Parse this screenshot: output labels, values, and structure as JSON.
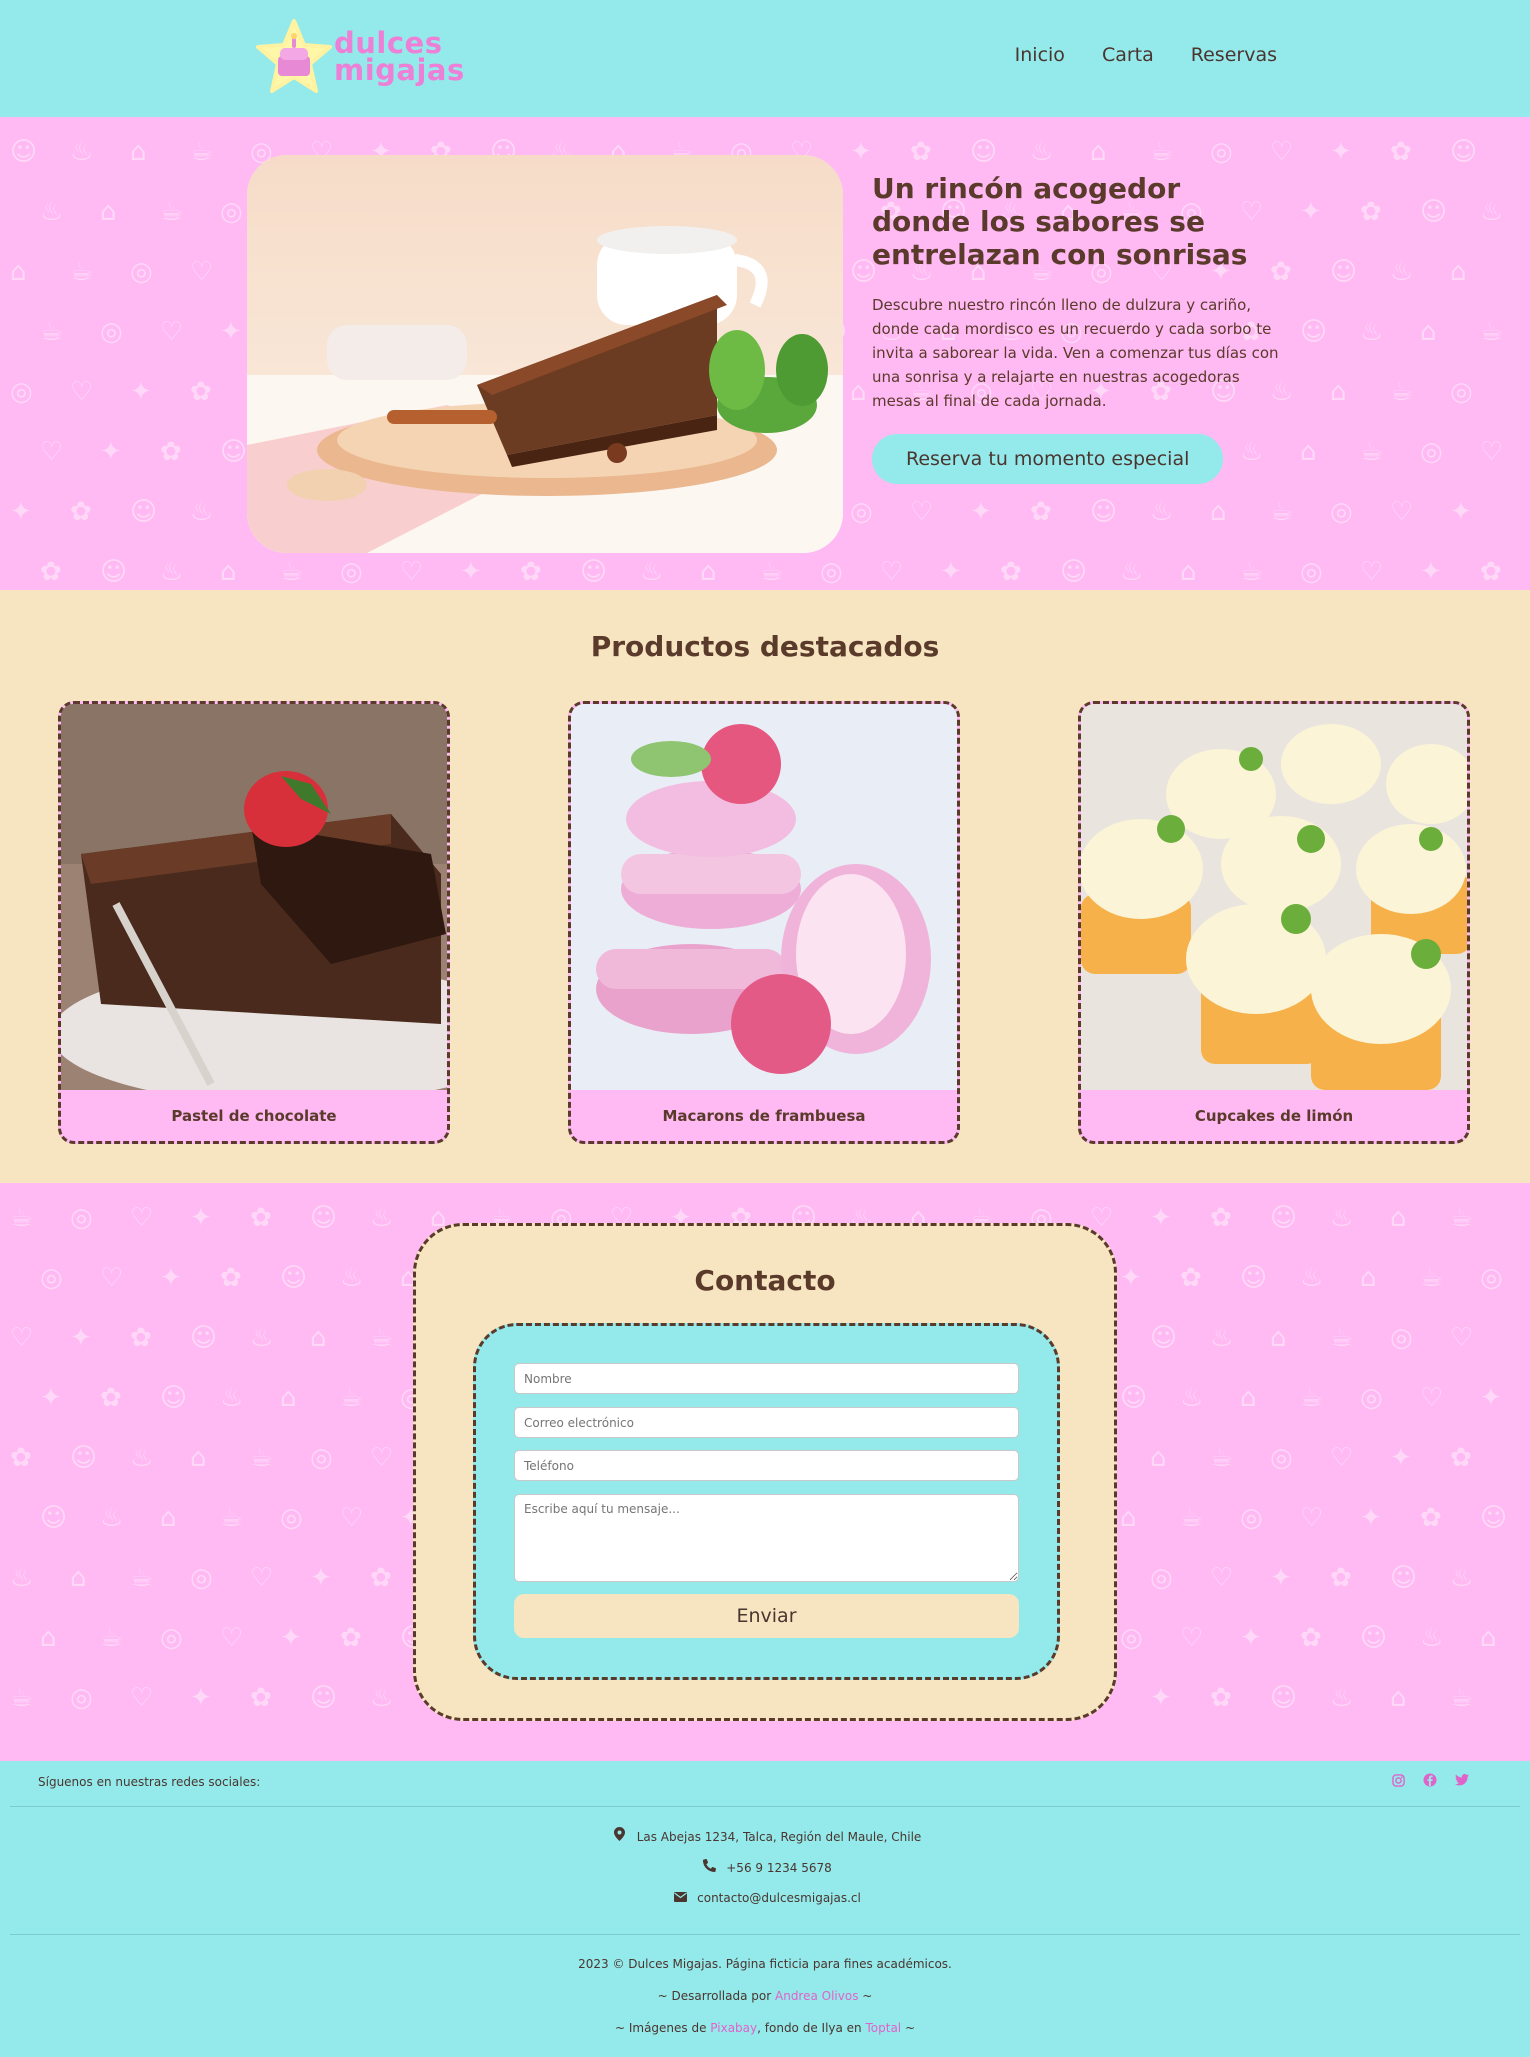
{
  "brand": {
    "line1": "dulces",
    "line2": "migajas"
  },
  "nav": {
    "items": [
      "Inicio",
      "Carta",
      "Reservas"
    ]
  },
  "hero": {
    "title": "Un rincón acogedor donde los sabores se entrelazan con sonrisas",
    "description": "Descubre nuestro rincón lleno de dulzura y cariño, donde cada mordisco es un recuerdo y cada sorbo te invita a saborear la vida. Ven a comenzar tus días con una sonrisa y a relajarte en nuestras acogedoras mesas al final de cada jornada.",
    "button": "Reserva tu momento especial"
  },
  "products": {
    "heading": "Productos destacados",
    "items": [
      {
        "name": "Pastel de chocolate"
      },
      {
        "name": "Macarons de frambuesa"
      },
      {
        "name": "Cupcakes de limón"
      }
    ]
  },
  "contact": {
    "heading": "Contacto",
    "fields": {
      "name_placeholder": "Nombre",
      "email_placeholder": "Correo electrónico",
      "phone_placeholder": "Teléfono",
      "message_placeholder": "Escribe aquí tu mensaje..."
    },
    "submit": "Enviar"
  },
  "footer": {
    "social_label": "Síguenos en nuestras redes sociales:",
    "social_icons": [
      "instagram-icon",
      "facebook-icon",
      "twitter-icon"
    ],
    "address": "Las Abejas 1234, Talca, Región del Maule, Chile",
    "phone": "+56 9 1234 5678",
    "email": "contacto@dulcesmigajas.cl",
    "copyright": "2023 © Dulces Migajas. Página ficticia para fines académicos.",
    "dev_prefix": "~ Desarrollada por ",
    "dev_name": "Andrea Olivos",
    "dev_suffix": " ~",
    "img_prefix": "~ Imágenes de ",
    "img_source": "Pixabay",
    "img_middle": ", fondo de Ilya en ",
    "img_bg_source": "Toptal",
    "img_suffix": " ~"
  },
  "colors": {
    "header": "#94eaea",
    "pink": "#ffb9f3",
    "cream": "#f7e5c1",
    "brown": "#5a3a2a",
    "accent_pink": "#ee7fd6"
  }
}
